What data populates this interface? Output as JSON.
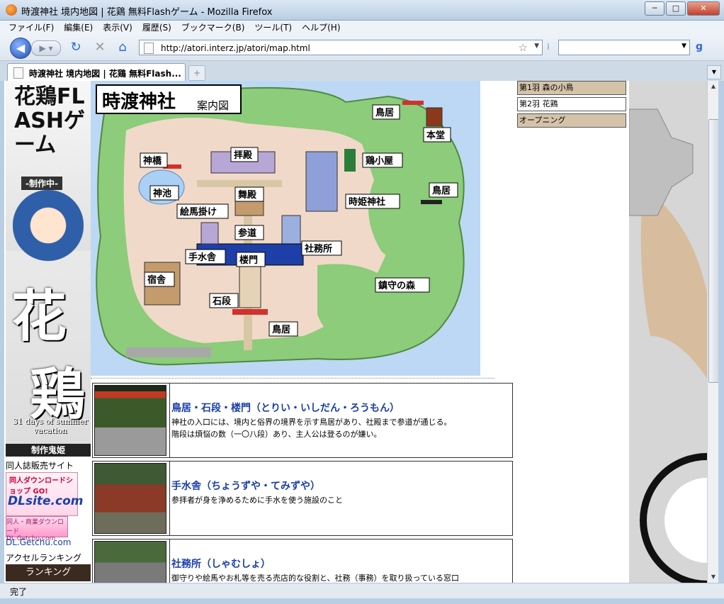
{
  "window": {
    "title": "時渡神社 境内地図 | 花鶏 無料Flashゲーム - Mozilla Firefox"
  },
  "menu": [
    "ファイル(F)",
    "編集(E)",
    "表示(V)",
    "履歴(S)",
    "ブックマーク(B)",
    "ツール(T)",
    "ヘルプ(H)"
  ],
  "nav": {
    "url": "http://atori.interz.jp/atori/map.html"
  },
  "tab": {
    "label": "時渡神社 境内地図 | 花鶏 無料Flash..."
  },
  "status": "完了",
  "left": {
    "banner_text": "花鶏FLASHゲーム",
    "made": "-制作中-",
    "big1": "花",
    "big2": "鶏",
    "days": "31 days of summer vacation",
    "kihime": "制作鬼姫",
    "doujin_label": "同人誌販売サイト",
    "dlsite_top": "同人ダウンロードショップ GO!",
    "dlsite_logo": "DLsite.com",
    "getchu_text": "同人・商業ダウンロード DL.Getchu.com",
    "getchu_link": "DL.Getchu.com",
    "accel_label": "アクセルランキング",
    "rank_button": "ランキング"
  },
  "map": {
    "title": "時渡神社",
    "subtitle": "案内図",
    "labels": {
      "torii_top": "鳥居",
      "hondo": "本堂",
      "shinkyo": "神橋",
      "haiden": "拝殿",
      "niwatori": "鶏小屋",
      "shinchi": "神池",
      "buden": "舞殿",
      "torii_right": "鳥居",
      "ema": "絵馬掛け",
      "tokihime": "時姫神社",
      "sando": "参道",
      "temizuya": "手水舎",
      "romon": "楼門",
      "shamusho": "社務所",
      "shukusha": "宿舎",
      "chinju": "鎮守の森",
      "ishidan": "石段",
      "torii_bottom": "鳥居"
    }
  },
  "entries": [
    {
      "title": "鳥居・石段・楼門（とりい・いしだん・ろうもん）",
      "line1": "神社の入口には、境内と俗界の境界を示す鳥居があり、社殿まで参道が通じる。",
      "line2": "階段は煩悩の数（一〇八段）あり、主人公は登るのが嫌い。"
    },
    {
      "title": "手水舎（ちょうずや・てみずや）",
      "line1": "参拝者が身を浄めるために手水を使う施設のこと",
      "line2": ""
    },
    {
      "title": "社務所（しゃむしょ）",
      "line1": "御守りや絵馬やお札等を売る売店的な役割と、社務（事務）を取り扱っている窓口",
      "line2": ""
    }
  ],
  "sidenav": [
    "第1羽 森の小鳥",
    "第2羽 花鶏",
    "オープニング"
  ]
}
